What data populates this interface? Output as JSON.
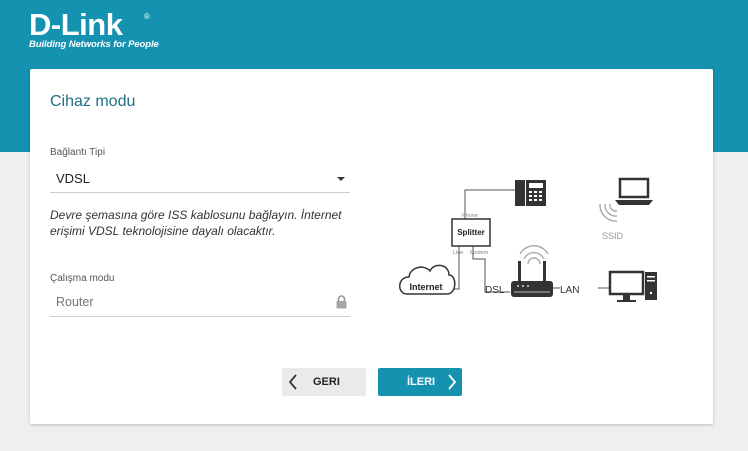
{
  "brand": {
    "logo_text": "D-Link",
    "registered_mark": "®",
    "tagline": "Building Networks for People"
  },
  "card": {
    "title": "Cihaz modu",
    "connection_type": {
      "label": "Bağlantı Tipi",
      "value": "VDSL"
    },
    "note": "Devre şemasına göre ISS kablosunu bağlayın. İnternet erişimi VDSL teknolojisine dayalı olacaktır.",
    "operation_mode": {
      "label": "Çalışma modu",
      "value": "Router"
    },
    "buttons": {
      "back": "GERI",
      "next": "İLERI"
    }
  },
  "diagram": {
    "splitter": "Splitter",
    "phone_port": "Phone",
    "line_port": "Line",
    "modem_port": "Modem",
    "internet": "Internet",
    "dsl": "DSL",
    "lan": "LAN",
    "ssid": "SSID"
  },
  "colors": {
    "header_bg": "#1592b0",
    "title_text": "#1f6f83",
    "primary_button": "#1592b0",
    "secondary_button": "#eaeaea",
    "page_bg": "#efefef"
  },
  "icons": {
    "select_caret": "caret-down-icon",
    "lock": "lock-icon",
    "back": "chevron-left-icon",
    "next": "chevron-right-icon"
  }
}
